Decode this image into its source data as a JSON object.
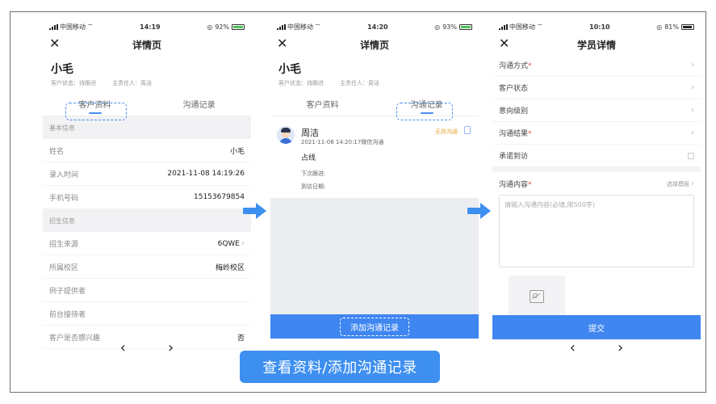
{
  "screen1": {
    "status": {
      "carrier": "中国移动",
      "time": "14:19",
      "battery": "92%"
    },
    "nav_title": "详情页",
    "customer_name": "小毛",
    "customer_status": "客户状态：待跟进",
    "owner": "主责任人：周洁",
    "tabs": [
      "客户资料",
      "沟通记录"
    ],
    "section_basic": "基本信息",
    "basic_rows": [
      {
        "label": "姓名",
        "value": "小毛"
      },
      {
        "label": "录入时间",
        "value": "2021-11-08 14:19:26"
      },
      {
        "label": "手机号码",
        "value": "15153679854"
      }
    ],
    "section_enroll": "招生信息",
    "enroll_rows": [
      {
        "label": "招生来源",
        "value": "6QWE"
      },
      {
        "label": "所属校区",
        "value": "梅岭校区"
      },
      {
        "label": "例子提供者",
        "value": ""
      },
      {
        "label": "前台接待者",
        "value": ""
      },
      {
        "label": "客户是否感兴趣",
        "value": "否"
      }
    ]
  },
  "screen2": {
    "status": {
      "carrier": "中国移动",
      "time": "14:20",
      "battery": "93%"
    },
    "nav_title": "详情页",
    "customer_name": "小毛",
    "customer_status": "客户状态：待跟进",
    "owner": "主责任人：周洁",
    "tabs": [
      "客户资料",
      "沟通记录"
    ],
    "record": {
      "name": "周洁",
      "time": "2021-11-08 14:20:17微信沟通",
      "status": "无效沟通",
      "content": "占线",
      "next_label": "下次跟进:",
      "visit_label": "到访日期:"
    },
    "add_button": "添加沟通记录"
  },
  "screen3": {
    "status": {
      "carrier": "中国移动",
      "time": "10:10",
      "battery": "81%"
    },
    "nav_title": "学员详情",
    "fields": [
      {
        "label": "沟通方式",
        "required": "*"
      },
      {
        "label": "客户状态",
        "required": ""
      },
      {
        "label": "意向级别",
        "required": ""
      },
      {
        "label": "沟通结果",
        "required": "*"
      }
    ],
    "promise_visit": "承诺到访",
    "content_label": "沟通内容",
    "content_required": "*",
    "select_template": "选择模板",
    "placeholder": "请输入沟通内容(必填,限500字)",
    "submit": "提交"
  },
  "caption": "查看资料/添加沟通记录",
  "pager": {
    "prev": "‹",
    "next": "›"
  },
  "colors": {
    "accent": "#3f86f1",
    "status_warn": "#e8a93a",
    "required": "#e24a4a"
  }
}
